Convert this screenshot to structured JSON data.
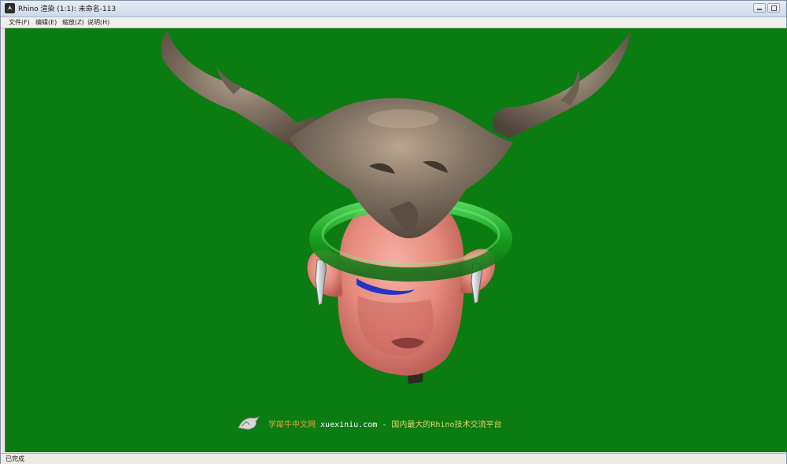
{
  "window": {
    "title": "Rhino 渲染 (1:1): 未命名-113"
  },
  "menu": {
    "items": [
      "文件(F)",
      "编辑(E)",
      "缩放(Z)",
      "说明(H)"
    ]
  },
  "viewport": {
    "background_color": "#0a7c12",
    "scene": "rendered-head-with-antlers"
  },
  "watermark": {
    "site_name": "学犀牛中文网",
    "url": "xuexiniu.com",
    "separator": "-",
    "description": "国内最大的Rhino技术交流平台"
  },
  "status": {
    "text": "已完成"
  },
  "colors": {
    "antler": "#7a6d5e",
    "skin": "#e88c7f",
    "ring": "#1fa82a",
    "accent_blue": "#2030c0"
  }
}
